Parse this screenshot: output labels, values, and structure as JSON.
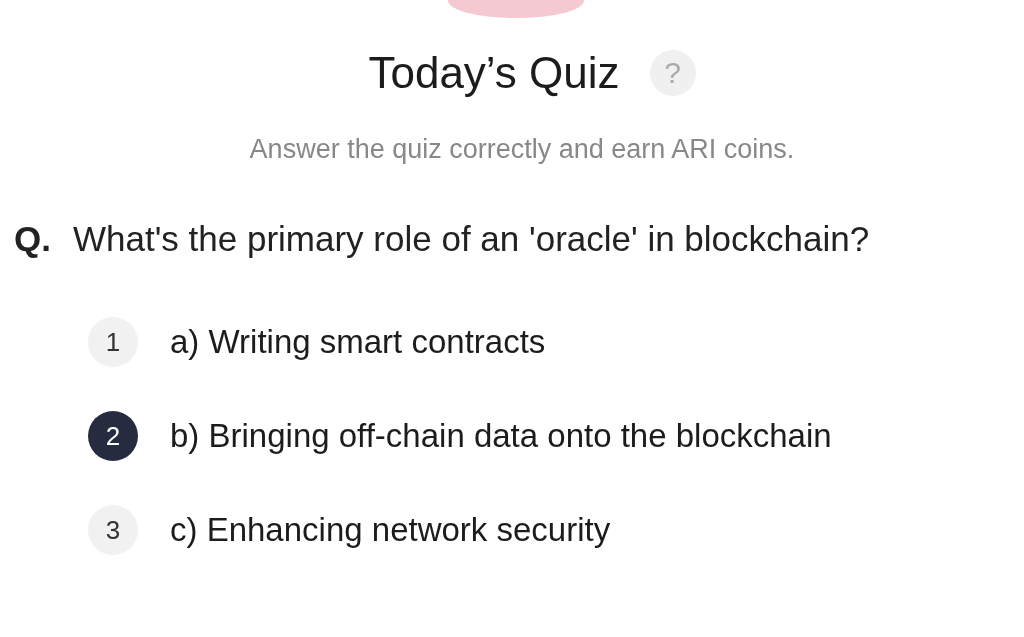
{
  "title": "Today’s Quiz",
  "help": "?",
  "subtitle": "Answer the quiz correctly and earn ARI coins.",
  "question": {
    "prefix": "Q.",
    "text": "What's the primary role of an 'oracle' in blockchain?"
  },
  "options": [
    {
      "number": "1",
      "text": "a) Writing smart contracts",
      "selected": false
    },
    {
      "number": "2",
      "text": "b) Bringing off-chain data onto the blockchain",
      "selected": true
    },
    {
      "number": "3",
      "text": "c) Enhancing network security",
      "selected": false
    }
  ]
}
